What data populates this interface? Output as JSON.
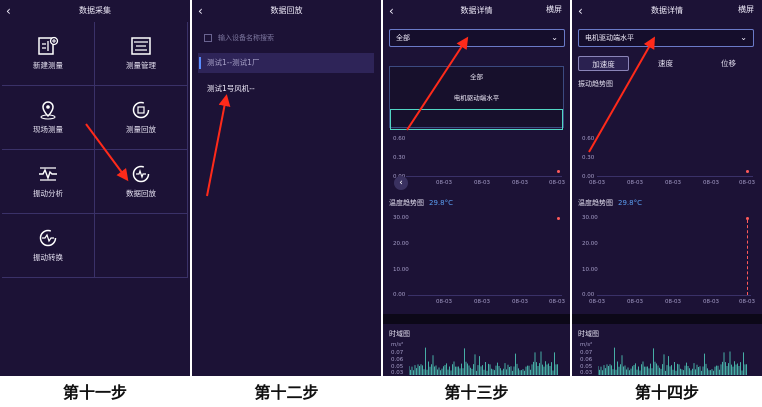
{
  "panel1": {
    "title": "数据采集",
    "tiles": [
      {
        "label": "新建测量"
      },
      {
        "label": "测量管理"
      },
      {
        "label": "现场测量"
      },
      {
        "label": "测量回放"
      },
      {
        "label": "振动分析"
      },
      {
        "label": "数据回放"
      },
      {
        "label": "振动转换"
      }
    ],
    "caption": "第十一步"
  },
  "panel2": {
    "title": "数据回放",
    "search_placeholder": "输入设备名称搜索",
    "items": [
      "测试1--测试1厂",
      "测试1号风机--"
    ],
    "caption": "第十二步"
  },
  "panel3": {
    "title": "数据详情",
    "landscape": "横屏",
    "dropdown_value": "全部",
    "options": [
      "全部",
      "电机驱动端水平",
      ""
    ],
    "vib_ticks": [
      "0.60",
      "0.30",
      "0.00"
    ],
    "x_dates": [
      "08-03",
      "08-03",
      "08-03",
      "08-03"
    ],
    "temp_label": "温度趋势图",
    "temp_value": "29.8°C",
    "temp_ticks": [
      "30.00",
      "20.00",
      "10.00",
      "0.00"
    ],
    "time_label": "时域图",
    "unit": "m/s²",
    "time_ticks": [
      "0.07",
      "0.06",
      "0.05",
      "0.03"
    ],
    "caption": "第十三步"
  },
  "panel4": {
    "title": "数据详情",
    "landscape": "横屏",
    "dropdown_value": "电机驱动端水平",
    "tabs": [
      "加速度",
      "速度",
      "位移"
    ],
    "vib_label": "振动趋势图",
    "vib_ticks": [
      "0.60",
      "0.30",
      "0.00"
    ],
    "x_dates": [
      "08-03",
      "08-03",
      "08-03",
      "08-03",
      "08-03"
    ],
    "temp_label": "温度趋势图",
    "temp_value": "29.8°C",
    "temp_ticks": [
      "30.00",
      "20.00",
      "10.00",
      "0.00"
    ],
    "time_label": "时域图",
    "unit": "m/s²",
    "time_ticks": [
      "0.07",
      "0.06",
      "0.05",
      "0.03"
    ],
    "caption": "第十四步"
  },
  "colors": {
    "panel_bg": "#1c1236",
    "arrow": "#ff2a1a",
    "accent": "#52d6c4",
    "temp": "#5a9cf0"
  }
}
